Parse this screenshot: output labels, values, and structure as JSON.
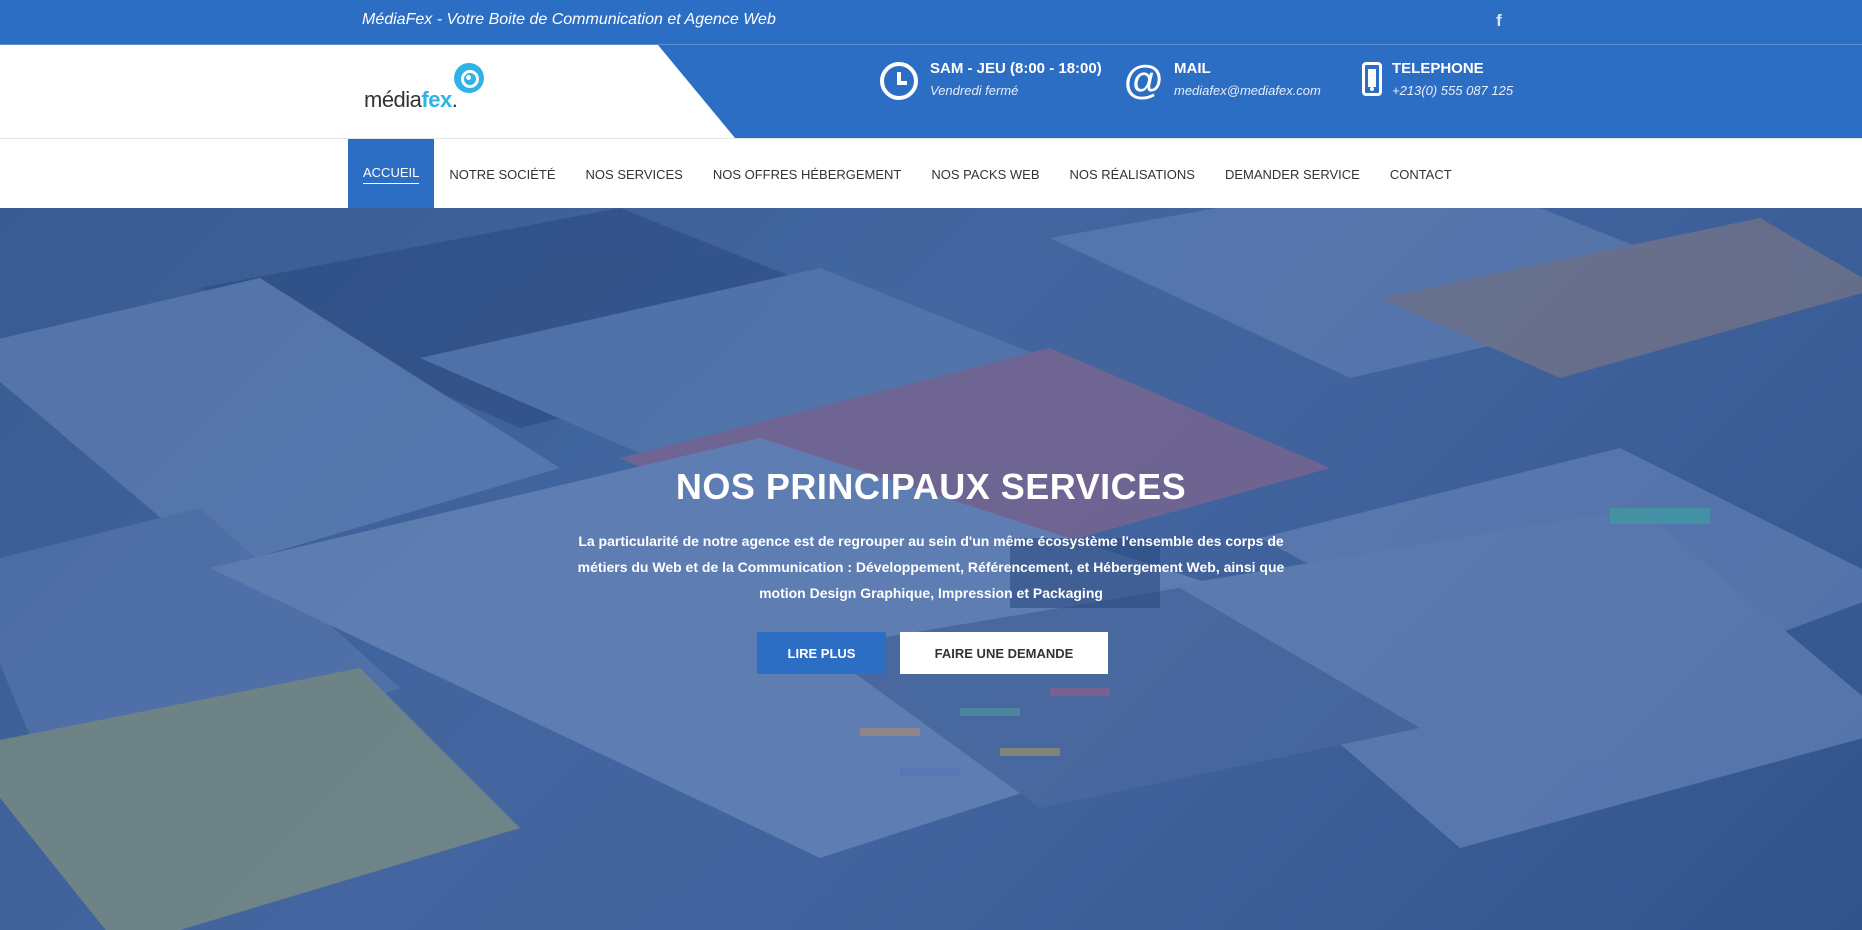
{
  "topbar": {
    "tagline": "MédiaFex - Votre Boite de Communication et Agence Web",
    "social_icon": "facebook-icon",
    "social_glyph": "f"
  },
  "logo": {
    "text_main": "média",
    "text_accent": "fex",
    "suffix": "."
  },
  "info": {
    "hours": {
      "icon": "clock-icon",
      "title": "SAM - JEU (8:00 - 18:00)",
      "sub": "Vendredi fermé"
    },
    "mail": {
      "icon": "at-icon",
      "glyph": "@",
      "title": "MAIL",
      "sub": "mediafex@mediafex.com"
    },
    "phone": {
      "icon": "phone-icon",
      "title": "TELEPHONE",
      "sub": "+213(0) 555 087 125"
    }
  },
  "nav": {
    "items": [
      {
        "label": "Accueil",
        "active": true
      },
      {
        "label": "Notre Société",
        "active": false
      },
      {
        "label": "Nos Services",
        "active": false
      },
      {
        "label": "Nos Offres Hébergement",
        "active": false
      },
      {
        "label": "Nos Packs Web",
        "active": false
      },
      {
        "label": "Nos Réalisations",
        "active": false
      },
      {
        "label": "Demander Service",
        "active": false
      },
      {
        "label": "Contact",
        "active": false
      }
    ]
  },
  "hero": {
    "title": "NOS PRINCIPAUX SERVICES",
    "text": "La particularité de notre agence est de regrouper au sein d'un même écosystème l'ensemble des corps de métiers du Web et de la Communication : Développement, Référencement, et Hébergement Web, ainsi que motion Design Graphique, Impression et Packaging",
    "primary_button": "Lire Plus",
    "secondary_button": "Faire une demande"
  },
  "colors": {
    "brand_blue": "#2d6ec5",
    "logo_cyan": "#2eb3e6"
  }
}
